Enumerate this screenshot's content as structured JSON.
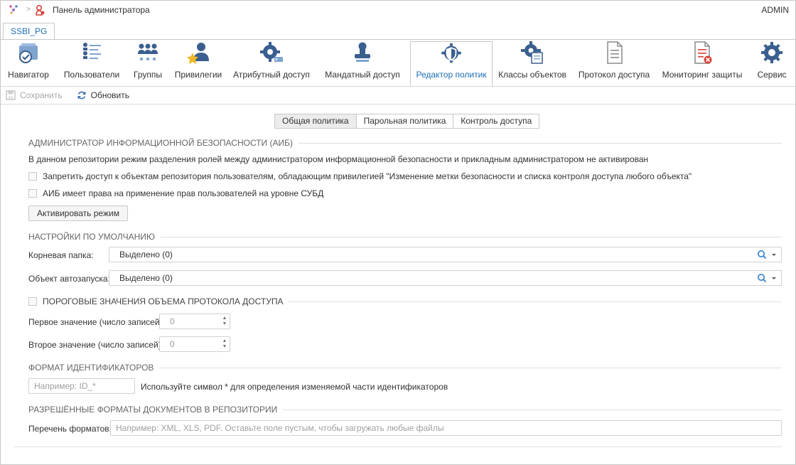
{
  "header": {
    "crumb_sep": ">",
    "page_title": "Панель администратора",
    "user": "ADMIN"
  },
  "repo_tab": "SSBI_PG",
  "ribbon": {
    "items": [
      {
        "label": "Навигатор",
        "icon": "navigator-icon"
      },
      {
        "label": "Пользователи",
        "icon": "users-list-icon"
      },
      {
        "label": "Группы",
        "icon": "groups-icon"
      },
      {
        "label": "Привилегии",
        "icon": "privileges-icon"
      },
      {
        "label": "Атрибутный доступ",
        "icon": "attribute-access-icon"
      },
      {
        "label": "Мандатный доступ",
        "icon": "mandatory-access-icon"
      },
      {
        "label": "Редактор политик",
        "icon": "policy-editor-icon",
        "active": true
      },
      {
        "label": "Классы объектов",
        "icon": "object-classes-icon"
      },
      {
        "label": "Протокол доступа",
        "icon": "access-log-icon"
      },
      {
        "label": "Мониторинг защиты",
        "icon": "security-monitoring-icon"
      },
      {
        "label": "Сервис",
        "icon": "service-icon"
      }
    ]
  },
  "toolbar": {
    "save": "Сохранить",
    "refresh": "Обновить"
  },
  "subtabs": [
    "Общая политика",
    "Парольная политика",
    "Контроль доступа"
  ],
  "aib": {
    "title": "АДМИНИСТРАТОР ИНФОРМАЦИОННОЙ БЕЗОПАСНОСТИ (АИБ)",
    "info": "В данном репозитории режим разделения ролей между администратором информационной безопасности и прикладным администратором не активирован",
    "cb1": "Запретить доступ к объектам репозитория пользователям, обладающим привилегией \"Изменение метки безопасности и списка контроля доступа любого объекта\"",
    "cb2": "АИБ имеет права на применение прав пользователей на уровне СУБД",
    "activate": "Активировать режим"
  },
  "defaults": {
    "title": "НАСТРОЙКИ ПО УМОЛЧАНИЮ",
    "root_label": "Корневая папка:",
    "root_value": "Выделено (0)",
    "autorun_label": "Объект автозапуска:",
    "autorun_value": "Выделено (0)"
  },
  "thresholds": {
    "title": "ПОРОГОВЫЕ ЗНАЧЕНИЯ ОБЪЕМА ПРОТОКОЛА ДОСТУПА",
    "first_label": "Первое значение (число записей):",
    "first_value": "0",
    "second_label": "Второе значение (число записей):",
    "second_value": "0"
  },
  "idformat": {
    "title": "ФОРМАТ ИДЕНТИФИКАТОРОВ",
    "placeholder": "Например: ID_*",
    "hint": "Используйте символ * для определения изменяемой части идентификаторов"
  },
  "docformats": {
    "title": "РАЗРЕШЁННЫЕ ФОРМАТЫ ДОКУМЕНТОВ В РЕПОЗИТОРИИ",
    "label": "Перечень форматов:",
    "placeholder": "Например: XML, XLS, PDF. Оставьте поле пустым, чтобы загружать любые файлы"
  },
  "colors": {
    "accent": "#1e6fb5",
    "icon_blue": "#3a5f8f",
    "icon_light": "#7fa4cf",
    "star": "#f2b824",
    "danger": "#d9413a"
  }
}
